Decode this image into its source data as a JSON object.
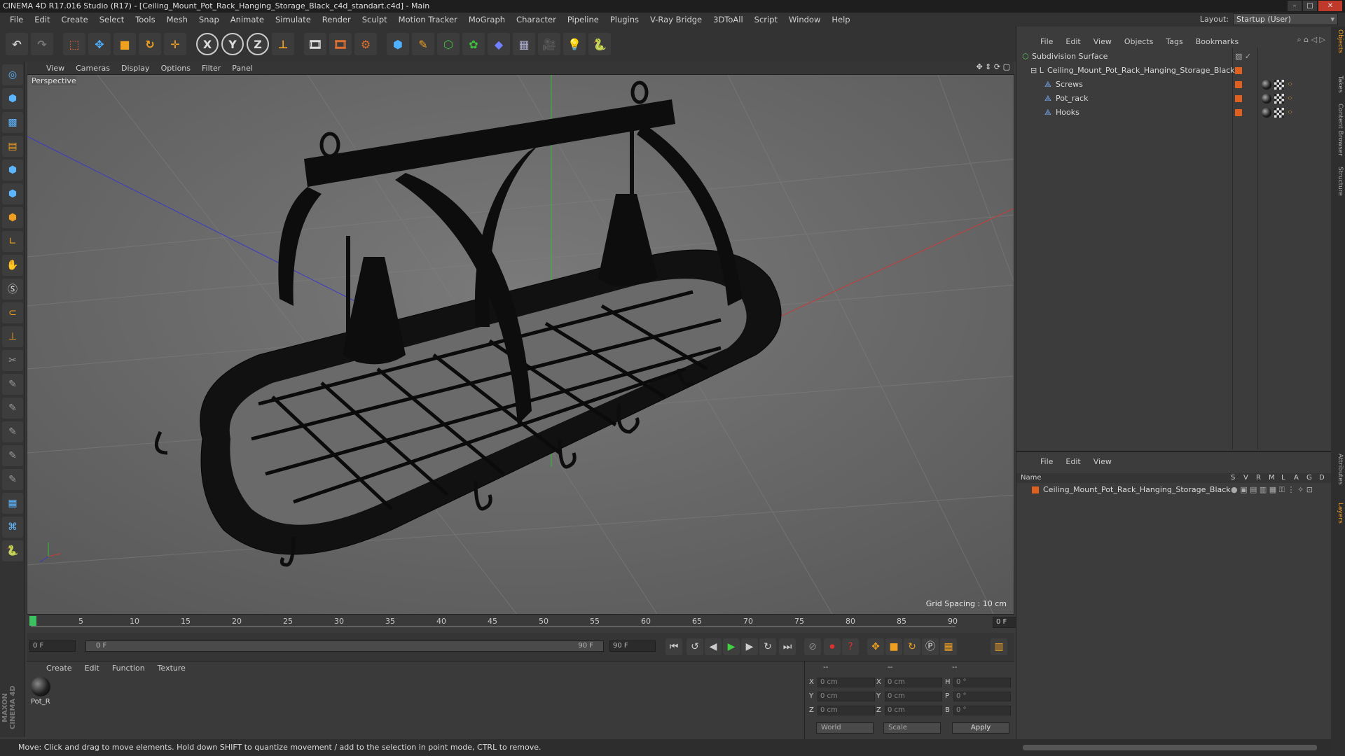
{
  "window": {
    "title": "CINEMA 4D R17.016 Studio (R17) - [Ceiling_Mount_Pot_Rack_Hanging_Storage_Black_c4d_standart.c4d] - Main"
  },
  "menubar": {
    "items": [
      "File",
      "Edit",
      "Create",
      "Select",
      "Tools",
      "Mesh",
      "Snap",
      "Animate",
      "Simulate",
      "Render",
      "Sculpt",
      "Motion Tracker",
      "MoGraph",
      "Character",
      "Pipeline",
      "Plugins",
      "V-Ray Bridge",
      "3DToAll",
      "Script",
      "Window",
      "Help"
    ],
    "layout_label": "Layout:",
    "layout_value": "Startup (User)"
  },
  "toolbar": {
    "axis_x": "X",
    "axis_y": "Y",
    "axis_z": "Z"
  },
  "viewport": {
    "menu": [
      "View",
      "Cameras",
      "Display",
      "Options",
      "Filter",
      "Panel"
    ],
    "label": "Perspective",
    "grid_spacing": "Grid Spacing : 10 cm"
  },
  "timeline": {
    "ticks": [
      "0",
      "5",
      "10",
      "15",
      "20",
      "25",
      "30",
      "35",
      "40",
      "45",
      "50",
      "55",
      "60",
      "65",
      "70",
      "75",
      "80",
      "85",
      "90"
    ],
    "current_frame": "0 F"
  },
  "transport": {
    "start_field": "0 F",
    "range_start": "0 F",
    "range_end": "90 F",
    "end_field": "90 F"
  },
  "material_manager": {
    "menu": [
      "Create",
      "Edit",
      "Function",
      "Texture"
    ],
    "material_name": "Pot_R"
  },
  "coordinates": {
    "headers": [
      "--",
      "--",
      "--"
    ],
    "rows": [
      {
        "a": "X",
        "av": "0 cm",
        "b": "X",
        "bv": "0 cm",
        "c": "H",
        "cv": "0 °"
      },
      {
        "a": "Y",
        "av": "0 cm",
        "b": "Y",
        "bv": "0 cm",
        "c": "P",
        "cv": "0 °"
      },
      {
        "a": "Z",
        "av": "0 cm",
        "b": "Z",
        "bv": "0 cm",
        "c": "B",
        "cv": "0 °"
      }
    ],
    "world": "World",
    "scale": "Scale",
    "apply": "Apply"
  },
  "status": {
    "text": "Move: Click and drag to move elements. Hold down SHIFT to quantize movement / add to the selection in point mode, CTRL to remove."
  },
  "object_manager": {
    "menu": [
      "File",
      "Edit",
      "View",
      "Objects",
      "Tags",
      "Bookmarks"
    ],
    "objects": [
      {
        "name": "Subdivision Surface",
        "indent": 0
      },
      {
        "name": "Ceiling_Mount_Pot_Rack_Hanging_Storage_Black",
        "indent": 1
      },
      {
        "name": "Screws",
        "indent": 2
      },
      {
        "name": "Pot_rack",
        "indent": 2
      },
      {
        "name": "Hooks",
        "indent": 2
      }
    ]
  },
  "layer_manager": {
    "menu": [
      "File",
      "Edit",
      "View"
    ],
    "columns": [
      "Name",
      "S",
      "V",
      "R",
      "M",
      "L",
      "A",
      "G",
      "D"
    ],
    "layer_name": "Ceiling_Mount_Pot_Rack_Hanging_Storage_Black"
  },
  "right_tabs": [
    "Objects",
    "Takes",
    "Content Browser",
    "Structure",
    "Attributes",
    "Layers"
  ],
  "brand": "MAXON CINEMA 4D",
  "colors": {
    "accent_blue": "#4fb0ff",
    "layer_orange": "#e06020",
    "object_green": "#5fc05f"
  }
}
